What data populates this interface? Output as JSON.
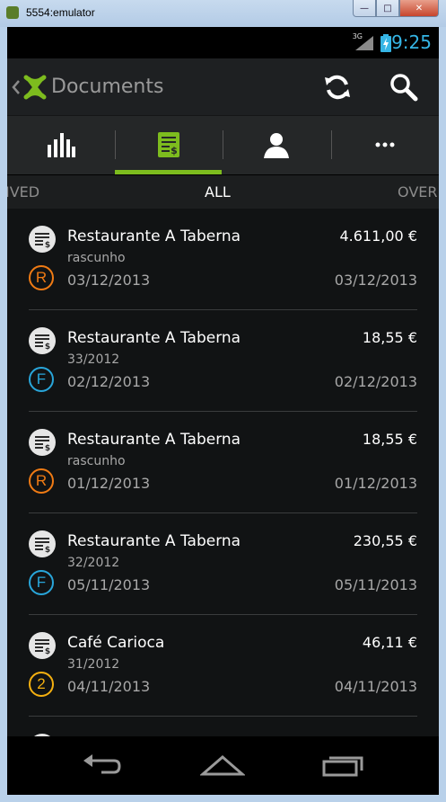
{
  "window": {
    "title": "5554:emulator",
    "controls": {
      "minimize": "—",
      "maximize": "□",
      "close": "✕"
    }
  },
  "status_bar": {
    "network": "3G",
    "time": "9:25",
    "battery_color": "#35b5e5"
  },
  "action_bar": {
    "title": "Documents",
    "logo_color": "#7dbc1e",
    "actions": [
      "refresh-icon",
      "search-icon"
    ]
  },
  "tabs": [
    {
      "icon": "bar-chart-icon",
      "active": false
    },
    {
      "icon": "invoice-document-icon",
      "active": true
    },
    {
      "icon": "person-icon",
      "active": false
    },
    {
      "icon": "more-dots-icon",
      "active": false
    }
  ],
  "filters": {
    "left": "IVED",
    "center": "ALL",
    "right": "OVER"
  },
  "documents": [
    {
      "name": "Restaurante A Taberna",
      "ref": "rascunho",
      "date": "03/12/2013",
      "amount": "4.611,00 €",
      "due_date": "03/12/2013",
      "badge": "R",
      "badge_color": "#f07b14"
    },
    {
      "name": "Restaurante A Taberna",
      "ref": "33/2012",
      "date": "02/12/2013",
      "amount": "18,55 €",
      "due_date": "02/12/2013",
      "badge": "F",
      "badge_color": "#29a6da"
    },
    {
      "name": "Restaurante A Taberna",
      "ref": "rascunho",
      "date": "01/12/2013",
      "amount": "18,55 €",
      "due_date": "01/12/2013",
      "badge": "R",
      "badge_color": "#f07b14"
    },
    {
      "name": "Restaurante A Taberna",
      "ref": "32/2012",
      "date": "05/11/2013",
      "amount": "230,55 €",
      "due_date": "05/11/2013",
      "badge": "F",
      "badge_color": "#29a6da"
    },
    {
      "name": "Café Carioca",
      "ref": "31/2012",
      "date": "04/11/2013",
      "amount": "46,11 €",
      "due_date": "04/11/2013",
      "badge": "2",
      "badge_color": "#f5b010"
    }
  ],
  "nav_bar": [
    "back-icon",
    "home-icon",
    "recent-apps-icon"
  ]
}
